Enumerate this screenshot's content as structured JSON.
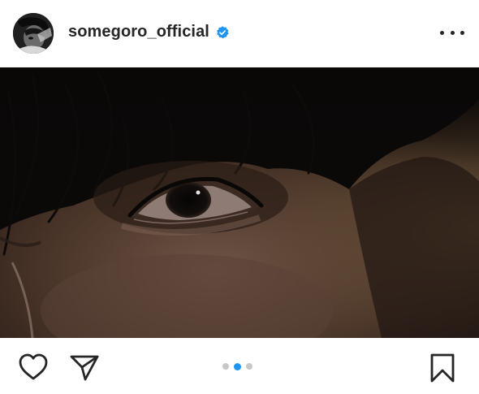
{
  "post": {
    "username": "somegoro_official",
    "verified": true,
    "carousel": {
      "total": 3,
      "active_index": 1
    }
  },
  "icons": {
    "avatar": "profile-avatar",
    "verified": "verified-badge-icon",
    "more": "more-options-icon",
    "like": "heart-icon",
    "share": "paper-plane-icon",
    "save": "bookmark-icon"
  },
  "colors": {
    "verified_blue": "#1e95f2",
    "text": "#262626",
    "dot_inactive": "#c7c7c7"
  }
}
